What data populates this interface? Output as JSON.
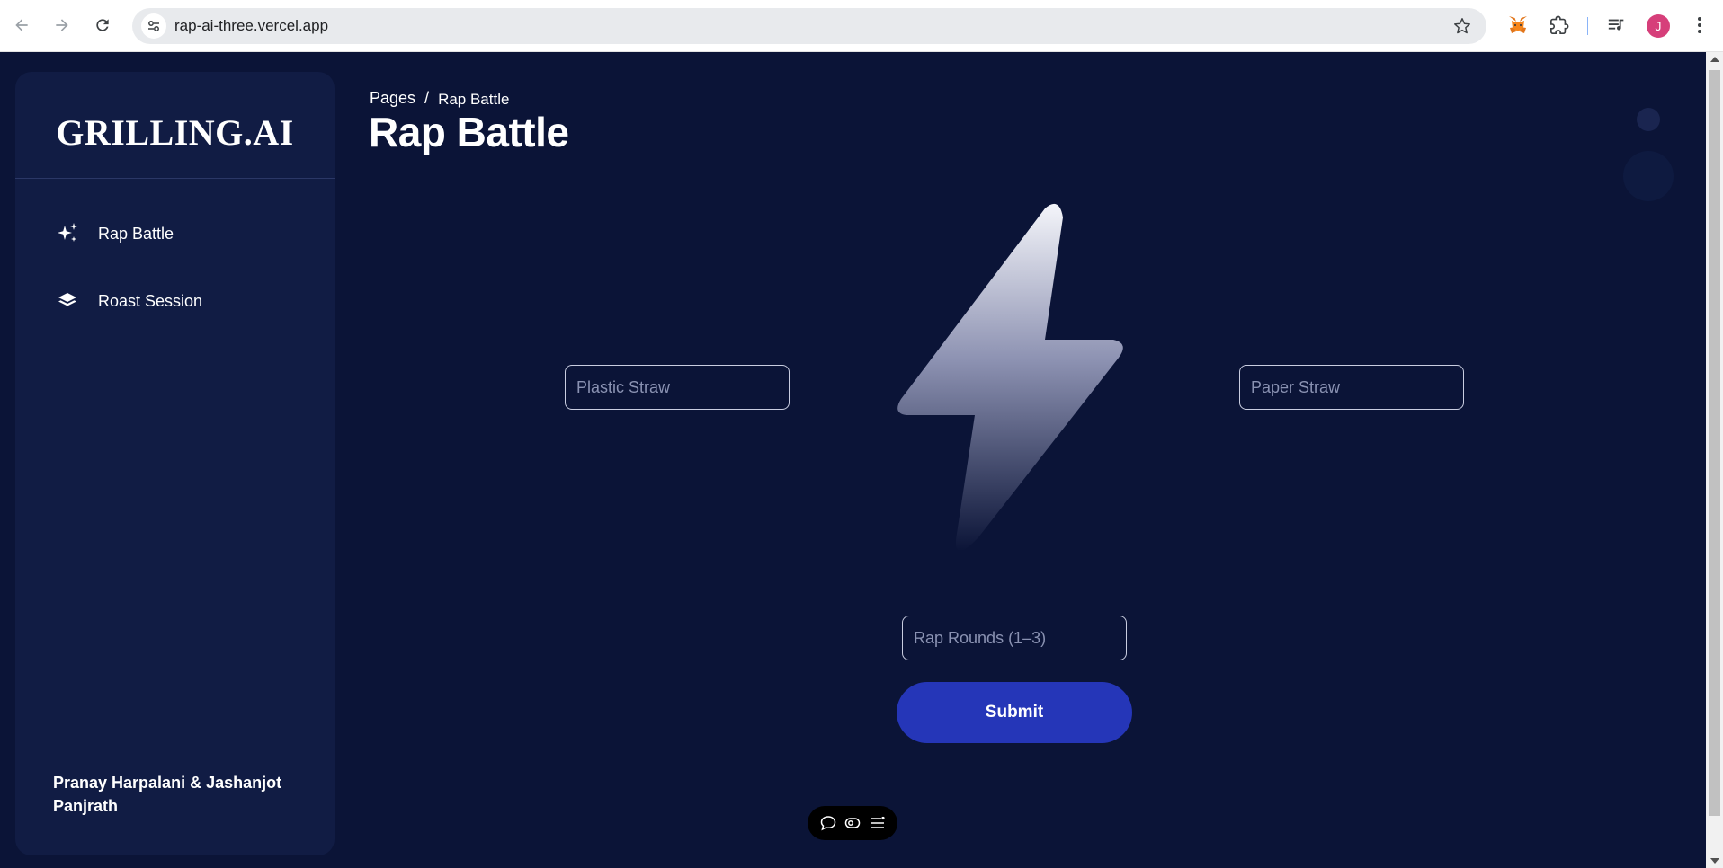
{
  "browser": {
    "url": "rap-ai-three.vercel.app",
    "avatar_letter": "J",
    "icons": [
      "back-arrow-icon",
      "forward-arrow-icon",
      "reload-icon",
      "site-settings-icon",
      "star-icon",
      "metamask-icon",
      "extensions-icon",
      "media-control-icon",
      "profile-avatar",
      "more-menu-icon"
    ]
  },
  "sidebar": {
    "brand": "GRILLING.AI",
    "items": [
      {
        "label": "Rap Battle",
        "icon": "sparkles-icon"
      },
      {
        "label": "Roast Session",
        "icon": "layers-icon"
      }
    ],
    "authors": "Pranay Harpalani & Jashanjot Panjrath"
  },
  "header": {
    "breadcrumb_root": "Pages",
    "breadcrumb_separator": "/",
    "breadcrumb_current": "Rap Battle",
    "title": "Rap Battle"
  },
  "form": {
    "left_placeholder": "Plastic Straw",
    "right_placeholder": "Paper Straw",
    "rounds_placeholder": "Rap Rounds (1–3)",
    "submit_label": "Submit"
  },
  "colors": {
    "background": "#0b1437",
    "sidebar": "#111c44",
    "accent": "#2536b8"
  },
  "toolbar_icons": [
    "comment-icon",
    "eye-toggle-icon",
    "settings-sliders-icon"
  ]
}
